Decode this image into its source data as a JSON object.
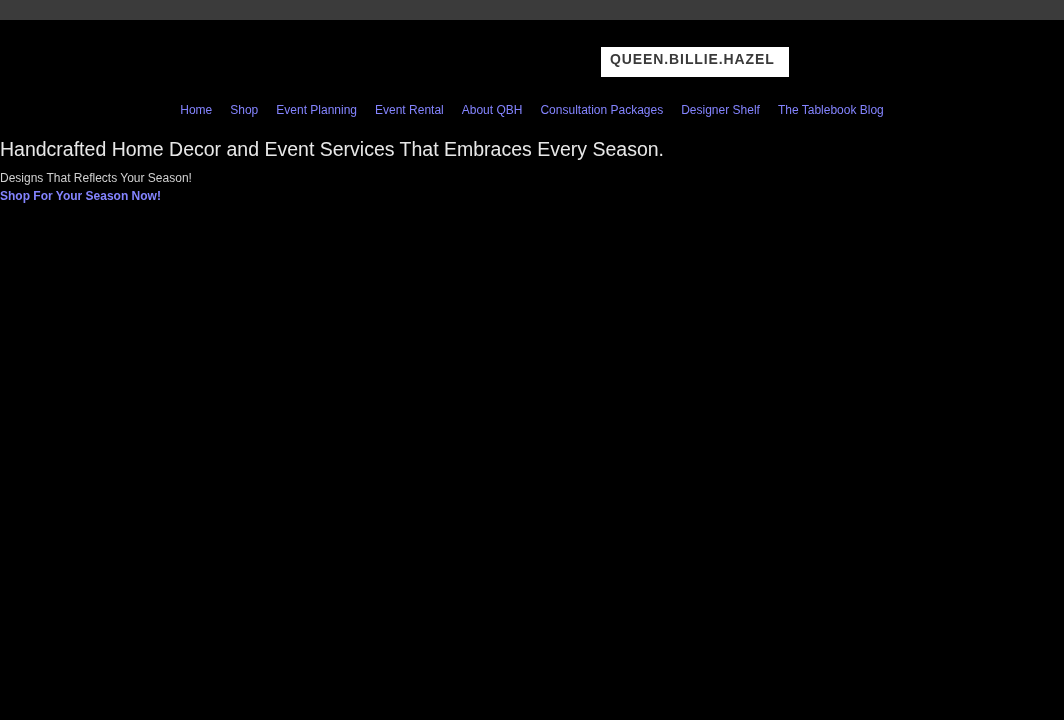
{
  "logo": {
    "text": "QUEEN.BILLIE.HAZEL"
  },
  "nav": {
    "items": [
      {
        "label": "Home"
      },
      {
        "label": "Shop"
      },
      {
        "label": "Event Planning"
      },
      {
        "label": "Event Rental"
      },
      {
        "label": "About QBH"
      },
      {
        "label": "Consultation Packages"
      },
      {
        "label": "Designer Shelf"
      },
      {
        "label": "The Tablebook Blog"
      }
    ]
  },
  "hero": {
    "heading": "Handcrafted Home Decor and Event Services That Embraces Every Season.",
    "subheading": "Designs That Reflects Your Season!",
    "link": "Shop For Your Season Now!"
  }
}
